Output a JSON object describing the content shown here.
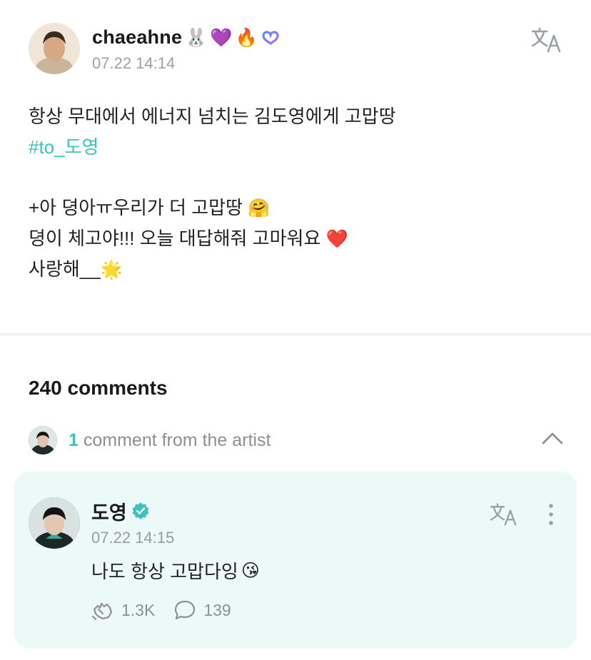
{
  "post": {
    "author": {
      "username": "chaeahne",
      "badges": [
        "🐰",
        "💜",
        "🔥"
      ],
      "timestamp": "07.22 14:14",
      "brand_icon": "weverse-logo-icon"
    },
    "translate_icon": "translate-icon",
    "body": {
      "line1": "항상 무대에서 에너지 넘치는 김도영에게 고맙땅",
      "hashtag": "#to_도영",
      "line3_text": "+아 뎡아ㅠ우리가 더 고맙땅",
      "line3_emoji": "🤗",
      "line4_text": "뎡이 체고야!!! 오늘 대답해줘 고마워요",
      "line4_emoji": "❤️",
      "line5_text": "사랑해__",
      "line5_emoji": "🌟"
    }
  },
  "comments": {
    "count_label": "240 comments",
    "artist_summary": {
      "count": "1",
      "label": "comment from the artist",
      "toggle_icon": "chevron-up-icon"
    },
    "artist_comment": {
      "name": "도영",
      "verified_icon": "verified-badge-icon",
      "timestamp": "07.22 14:15",
      "text": "나도 항상 고맙다잉",
      "emoji": "😘",
      "likes": "1.3K",
      "replies": "139",
      "like_icon": "like-icon",
      "reply_icon": "comment-bubble-icon",
      "more_icon": "more-vertical-icon"
    }
  },
  "colors": {
    "accent": "#3fc1c0",
    "card_background": "#ebfaf7",
    "muted_text": "#8f8f8f"
  }
}
